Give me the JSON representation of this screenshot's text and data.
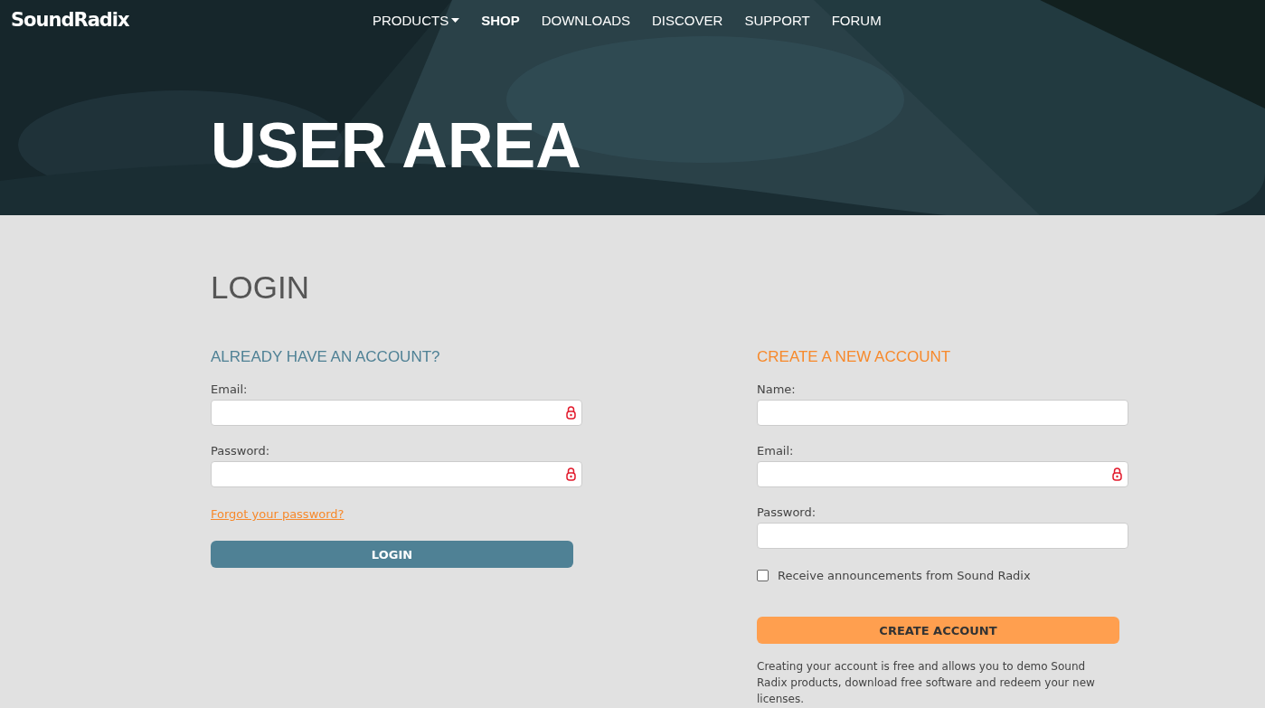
{
  "header": {
    "logo": "SoundRadix",
    "nav": [
      {
        "label": "PRODUCTS",
        "selected": false,
        "has_menu": true
      },
      {
        "label": "SHOP",
        "selected": true,
        "has_menu": false
      },
      {
        "label": "DOWNLOADS",
        "selected": false,
        "has_menu": false
      },
      {
        "label": "DISCOVER",
        "selected": false,
        "has_menu": false
      },
      {
        "label": "SUPPORT",
        "selected": false,
        "has_menu": false
      },
      {
        "label": "FORUM",
        "selected": false,
        "has_menu": false
      }
    ],
    "title": "USER AREA"
  },
  "page_title": "LOGIN",
  "login": {
    "heading": "ALREADY HAVE AN ACCOUNT?",
    "fields": [
      {
        "label": "Email:",
        "lock_icon": true
      },
      {
        "label": "Password:",
        "lock_icon": true
      }
    ],
    "forgot_link": "Forgot your password?",
    "button": "LOGIN"
  },
  "signup": {
    "heading": "CREATE A NEW ACCOUNT",
    "fields": [
      {
        "label": "Name:",
        "lock_icon": false
      },
      {
        "label": "Email:",
        "lock_icon": true
      },
      {
        "label": "Password:",
        "lock_icon": false
      }
    ],
    "checkbox": {
      "label": "Receive announcements from Sound Radix",
      "checked": false
    },
    "button": "CREATE ACCOUNT",
    "note": "Creating your account is free and allows you to demo Sound Radix products, download free software and redeem your new licenses."
  }
}
